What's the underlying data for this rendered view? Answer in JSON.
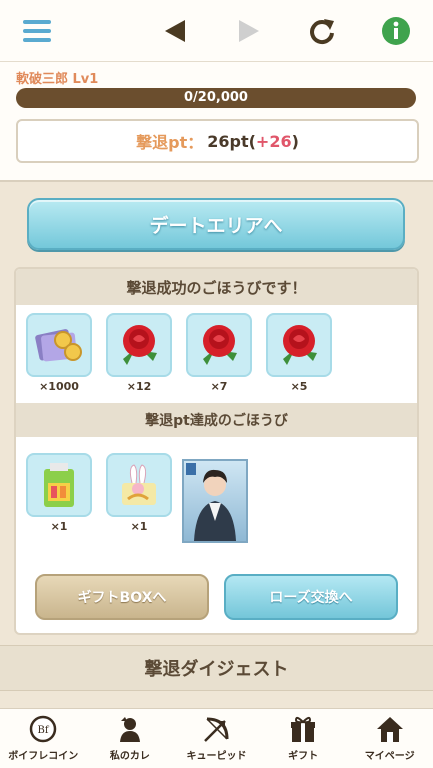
{
  "status": {
    "player_name": "軟破三郎 Lv1",
    "hp_text": "0/20,000",
    "hp_fraction": 0,
    "pt_label": "撃退pt：",
    "pt_value": "26pt",
    "pt_open": " (",
    "pt_plus": "+26",
    "pt_close": ")"
  },
  "main": {
    "date_area_label": "デートエリアへ",
    "victory_header": "撃退成功のごほうびです！",
    "victory_items": [
      {
        "icon": "coin-ticket-icon",
        "qty": "×1000"
      },
      {
        "icon": "red-rose-icon",
        "qty": "×12"
      },
      {
        "icon": "red-rose-icon",
        "qty": "×7"
      },
      {
        "icon": "red-rose-icon",
        "qty": "×5"
      }
    ],
    "pt_reward_header": "撃退pt達成のごほうび",
    "pt_items": [
      {
        "icon": "energy-drink-icon",
        "qty": "×1"
      },
      {
        "icon": "bunny-gift-icon",
        "qty": "×1"
      }
    ],
    "gift_box_button": "ギフトBOXへ",
    "rose_exchange_button": "ローズ交換へ",
    "digest_title": "撃退ダイジェスト"
  },
  "bottom_nav": [
    {
      "icon": "boyfriend-coin-icon",
      "label": "ボイフレコイン"
    },
    {
      "icon": "my-boyfriend-icon",
      "label": "私のカレ"
    },
    {
      "icon": "cupid-bow-icon",
      "label": "キューピッド"
    },
    {
      "icon": "gift-icon",
      "label": "ギフト"
    },
    {
      "icon": "house-icon",
      "label": "マイページ"
    }
  ],
  "colors": {
    "accent_blue": "#74c8da",
    "hp_bar": "#6b4e2e",
    "pt_label": "#e59a5c",
    "pt_plus": "#e0566a"
  }
}
